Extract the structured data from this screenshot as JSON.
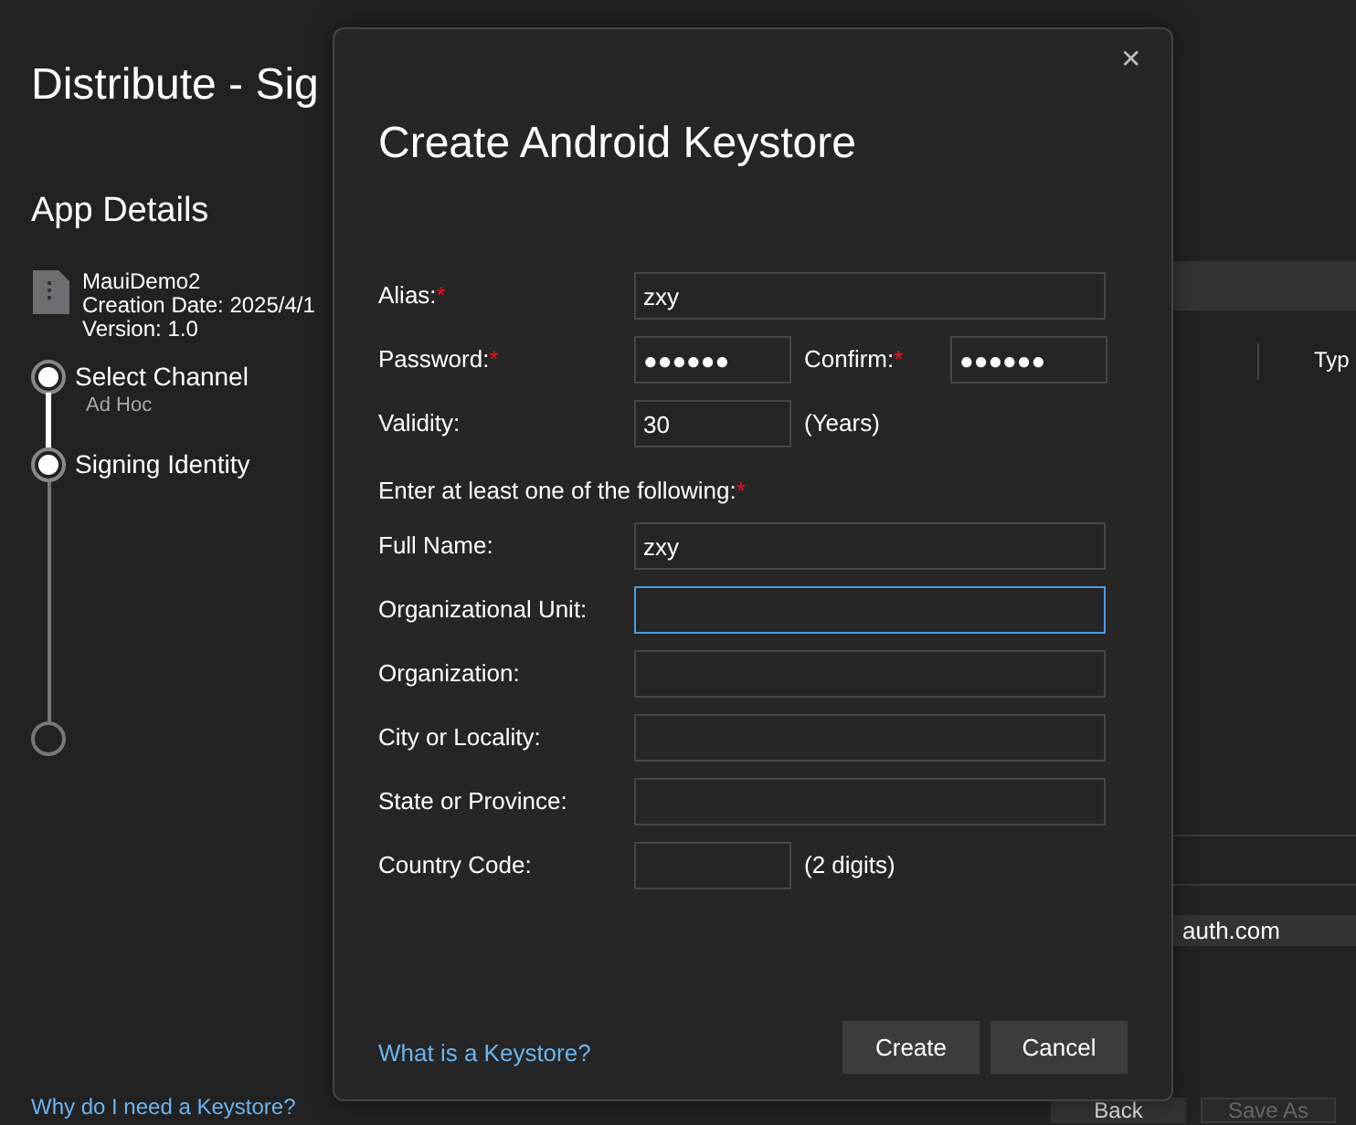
{
  "window": {
    "title": "Distribute - Sig"
  },
  "sidebar": {
    "heading": "App Details",
    "app": {
      "name": "MauiDemo2",
      "creation_date": "Creation Date: 2025/4/1",
      "version": "Version: 1.0"
    },
    "steps": [
      {
        "label": "Select Channel",
        "detail": "Ad Hoc",
        "kind": "reached"
      },
      {
        "label": "Signing Identity",
        "kind": "reached"
      },
      {
        "kind": "pending"
      }
    ],
    "help_link": "Why do I need a Keystore?"
  },
  "background": {
    "column_2": "Typ",
    "field_text": "auth.com",
    "buttons": [
      {
        "label": "Back",
        "disabled": false
      },
      {
        "label": "Save As",
        "disabled": true
      }
    ]
  },
  "dialog": {
    "title": "Create Android Keystore",
    "close": "✕",
    "top_rows": [
      {
        "label": "Alias:",
        "required_mark": "*",
        "value": "zxy",
        "short": false
      },
      {
        "label": "Password:",
        "required_mark": "*",
        "value": "●●●●●●",
        "short": true,
        "second_label": "Confirm:",
        "second_required_mark": "*",
        "second_value": "●●●●●●"
      },
      {
        "label": "Validity:",
        "value": "30",
        "short": true,
        "suffix": "(Years)"
      }
    ],
    "section_label": "Enter at least one of the following:",
    "section_required_mark": "*",
    "name_rows": [
      {
        "label": "Full Name:",
        "value": "zxy",
        "short": false,
        "focused": false
      },
      {
        "label": "Organizational Unit:",
        "short": false,
        "focused": true
      },
      {
        "label": "Organization:",
        "short": false,
        "focused": false
      },
      {
        "label": "City or Locality:",
        "short": false,
        "focused": false
      },
      {
        "label": "State or Province:",
        "short": false,
        "focused": false
      },
      {
        "label": "Country Code:",
        "short": true,
        "suffix": "(2 digits)",
        "focused": false
      }
    ],
    "help_link": "What is a Keystore?",
    "buttons": [
      "Create",
      "Cancel"
    ]
  }
}
